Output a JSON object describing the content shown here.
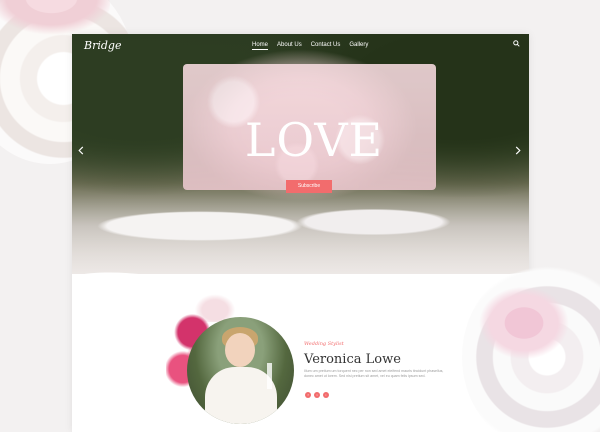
{
  "site": {
    "logo_text": "Bridge"
  },
  "nav": {
    "items": [
      {
        "label": "Home",
        "active": true
      },
      {
        "label": "About Us",
        "active": false
      },
      {
        "label": "Contact Us",
        "active": false
      },
      {
        "label": "Gallery",
        "active": false
      }
    ],
    "search_icon": "search-icon"
  },
  "hero": {
    "headline": "LOVE",
    "button_label": "Subscribe",
    "prev_icon": "chevron-left-icon",
    "next_icon": "chevron-right-icon"
  },
  "about": {
    "role": "Wedding Stylist",
    "name": "Veronica Lowe",
    "bio": "Illum um pretium um torquent nec per non sed amet eleifend mauris tincidunt phasellus, donec amet ut lorem. Sed nisi pretium sit amet, vel eu quam felis ipsum sed.",
    "socials": [
      "facebook-icon",
      "twitter-icon",
      "instagram-icon"
    ]
  },
  "colors": {
    "accent": "#f26c6d",
    "background": "#f3f1f1"
  }
}
